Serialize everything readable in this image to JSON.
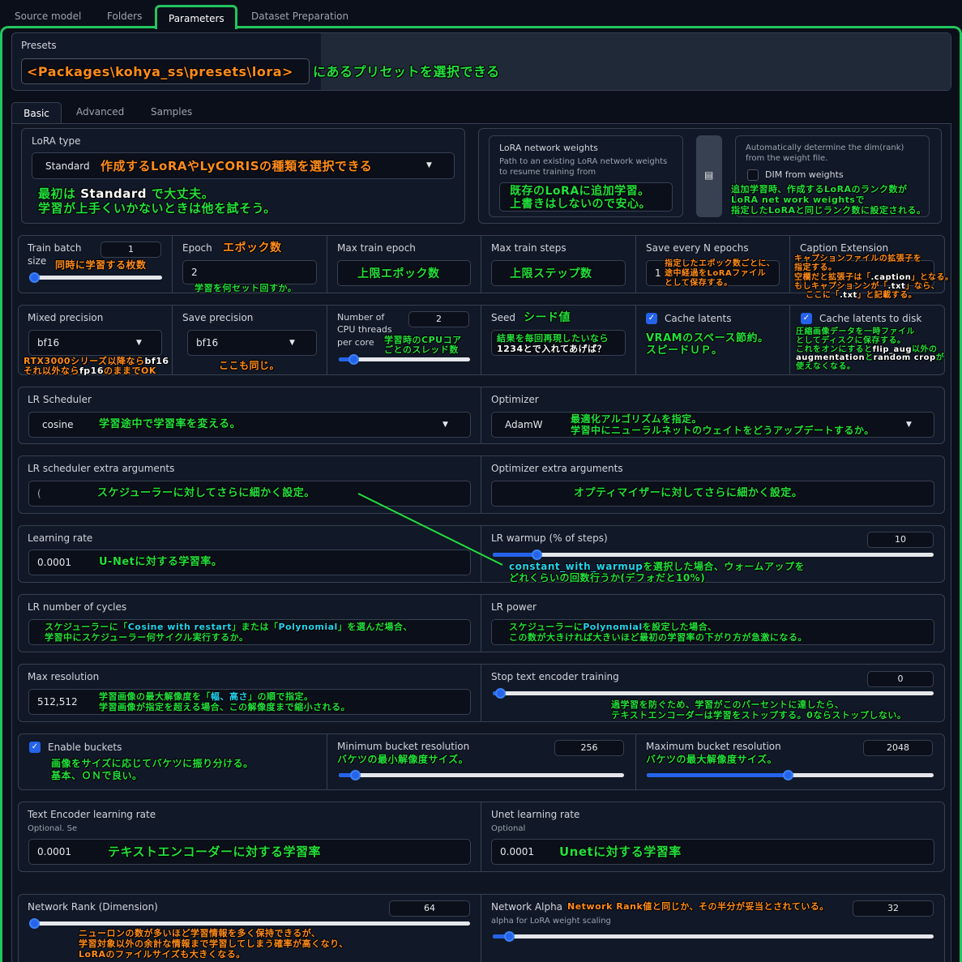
{
  "tabs_top": [
    "Source model",
    "Folders",
    "Parameters",
    "Dataset Preparation"
  ],
  "presets": {
    "label": "Presets",
    "path_text": "<Packages\\kohya_ss\\presets\\lora>",
    "note": "にあるプリセットを選択できる"
  },
  "subtabs": [
    "Basic",
    "Advanced",
    "Samples"
  ],
  "lora_type": {
    "label": "LoRA type",
    "value": "Standard",
    "note": "作成するLoRAやLyCORISの種類を選択できる",
    "note2_l1": "最初は",
    "note2_std": "Standard",
    "note2_l1b": "で大丈夫。",
    "note2_l2": "学習が上手くいかないときは他を試そう。"
  },
  "network_weights": {
    "label": "LoRA network weights",
    "desc1": "Path to an existing LoRA network weights",
    "desc2": "to resume training from",
    "note1": "既存のLoRAに追加学習。",
    "note2": "上書きはしないので安心。"
  },
  "dim_weights": {
    "desc1": "Automatically determine the dim(rank)",
    "desc2": "from the weight file.",
    "label": "DIM from weights",
    "note1": "追加学習時、作成するLoRAのランク数が",
    "note2": "LoRA net work weightsで",
    "note3": "指定したLoRAと同じランク数に設定される。"
  },
  "train_batch": {
    "label1": "Train batch",
    "label2": "size",
    "value": "1",
    "note": "同時に学習する枚数",
    "level": 0
  },
  "epoch": {
    "label": "Epoch",
    "note": "エポック数",
    "value": "2",
    "note2": "学習を何セット回すか。"
  },
  "max_epoch": {
    "label": "Max train epoch",
    "note": "上限エポック数"
  },
  "max_steps": {
    "label": "Max train steps",
    "note": "上限ステップ数"
  },
  "save_every": {
    "label": "Save every N epochs",
    "value": "1",
    "note1": "指定したエポック数ごとに、",
    "note2": "途中経過をLoRAファイル",
    "note3": "として保存する。"
  },
  "caption_ext": {
    "label": "Caption Extension",
    "n1": "キャプションファイルの拡張子を",
    "n2": "指定する。",
    "n3a": "空欄だと拡張子は「",
    "n3b": ".caption",
    "n3c": "」となる。",
    "n4a": "もしキャプションンが「",
    "n4b": ".txt",
    "n4c": "」なら、",
    "n5a": "ここに「",
    "n5b": ".txt",
    "n5c": "」と記載する。"
  },
  "mixed_precision": {
    "label": "Mixed precision",
    "value": "bf16",
    "n1a": "RTX3000シリーズ以降なら",
    "n1b": "bf16",
    "n2a": "それ以外なら",
    "n2b": "fp16",
    "n2c": "のままでOK"
  },
  "save_precision": {
    "label": "Save precision",
    "value": "bf16",
    "note": "ここも同じ。"
  },
  "cpu_threads": {
    "l1": "Number of",
    "l2": "CPU threads",
    "l3": "per core",
    "value": "2",
    "n1": "学習時のCPUコア",
    "n2": "ごとのスレッド数",
    "level": 0
  },
  "seed": {
    "label": "Seed",
    "note": "シード値",
    "n1": "結果を毎回再現したいなら",
    "n2": "1234とで入れてあげば？"
  },
  "cache_latents": {
    "label": "Cache latents",
    "n1": "VRAMのスペース節約。",
    "n2": "スピードＵＰ。"
  },
  "cache_disk": {
    "label": "Cache latents to disk",
    "n1": "圧縮画像データを一時ファイル",
    "n2": "としてディスクに保存する。",
    "n3": "これをオンにすると",
    "n3b": "flip_aug",
    "n3c": "以外の",
    "n4": "augmentation",
    "n4b": "と",
    "n4c": "random crop",
    "n4d": "が",
    "n5": "使えなくなる。"
  },
  "lr_scheduler": {
    "label": "LR Scheduler",
    "value": "cosine",
    "note": "学習途中で学習率を変える。"
  },
  "optimizer": {
    "label": "Optimizer",
    "value": "AdamW",
    "n1": "最適化アルゴリズムを指定。",
    "n2": "学習中にニューラルネットのウェイトをどうアップデートするか。"
  },
  "lr_extra": {
    "label": "LR scheduler extra arguments",
    "value": "(",
    "note": "スケジューラーに対してさらに細かく設定。"
  },
  "opt_extra": {
    "label": "Optimizer extra arguments",
    "note": "オプティマイザーに対してさらに細かく設定。"
  },
  "learning_rate": {
    "label": "Learning rate",
    "value": "0.0001",
    "note": "U-Netに対する学習率。"
  },
  "lr_warmup": {
    "label": "LR warmup (% of steps)",
    "value": "10",
    "n1a": "constant_with_warmup",
    "n1b": "を選択した場合、ウォームアップを",
    "n2": "どれくらいの回数行うか(デフォだと10%)",
    "level": 0.1
  },
  "lr_cycles": {
    "label": "LR number of cycles",
    "n1a": "スケジューラーに「",
    "n1b": "Cosine with restart",
    "n1c": "」または「",
    "n1d": "Polynomial",
    "n1e": "」を選んだ場合、",
    "n2": "学習中にスケジューラー何サイクル実行するか。"
  },
  "lr_power": {
    "label": "LR power",
    "n1a": "スケジューラーに",
    "n1b": "Polynomial",
    "n1c": "を設定した場合、",
    "n2": "この数が大きければ大きいほど最初の学習率の下がり方が急激になる。"
  },
  "max_res": {
    "label": "Max resolution",
    "value": "512,512",
    "n1a": "学習画像の最大解像度を「",
    "n1b": "幅、高さ",
    "n1c": "」の順で指定。",
    "n2": "学習画像が指定を超える場合、この解像度まで縮小される。"
  },
  "stop_te": {
    "label": "Stop text encoder training",
    "value": "0",
    "n1": "過学習を防ぐため、学習がこのパーセントに達したら、",
    "n2": "テキストエンコーダーは学習をストップする。0ならストップしない。",
    "level": 0
  },
  "buckets": {
    "label": "Enable buckets",
    "n1": "画像をサイズに応じてバケツに振り分ける。",
    "n2": "基本、ＯＮで良い。"
  },
  "min_bucket": {
    "label": "Minimum bucket resolution",
    "value": "256",
    "note": "バケツの最小解像度サイズ。",
    "level": 0.05
  },
  "max_bucket": {
    "label": "Maximum bucket resolution",
    "value": "2048",
    "note": "バケツの最大解像度サイズ。",
    "level": 0.5
  },
  "te_lr": {
    "label": "Text Encoder learning rate",
    "sub": "Optional. Se",
    "value": "0.0001",
    "note": "テキストエンコーダーに対する学習率"
  },
  "unet_lr": {
    "label": "Unet learning rate",
    "sub": "Optional",
    "value": "0.0001",
    "note": "Unetに対する学習率"
  },
  "net_rank": {
    "label": "Network Rank (Dimension)",
    "value": "64",
    "n1": "ニューロンの数が多いほど学習情報を多く保持できるが、",
    "n2": "学習対象以外の余計な情報まで学習してしまう確率が高くなり、",
    "n3": "LoRAのファイルサイズも大きくなる。",
    "level": 0
  },
  "net_alpha": {
    "label": "Network Alpha",
    "note": "Network Rank値と同じか、その半分が妥当とされている。",
    "sub": "alpha for LoRA weight scaling",
    "value": "32",
    "level": 0.03
  },
  "colors": {
    "accent_green": "#22c55e",
    "annot_green": "#22e03c",
    "annot_orange": "#ff8c1a",
    "annot_cyan": "#22d3ee",
    "slider_blue": "#2563eb"
  }
}
